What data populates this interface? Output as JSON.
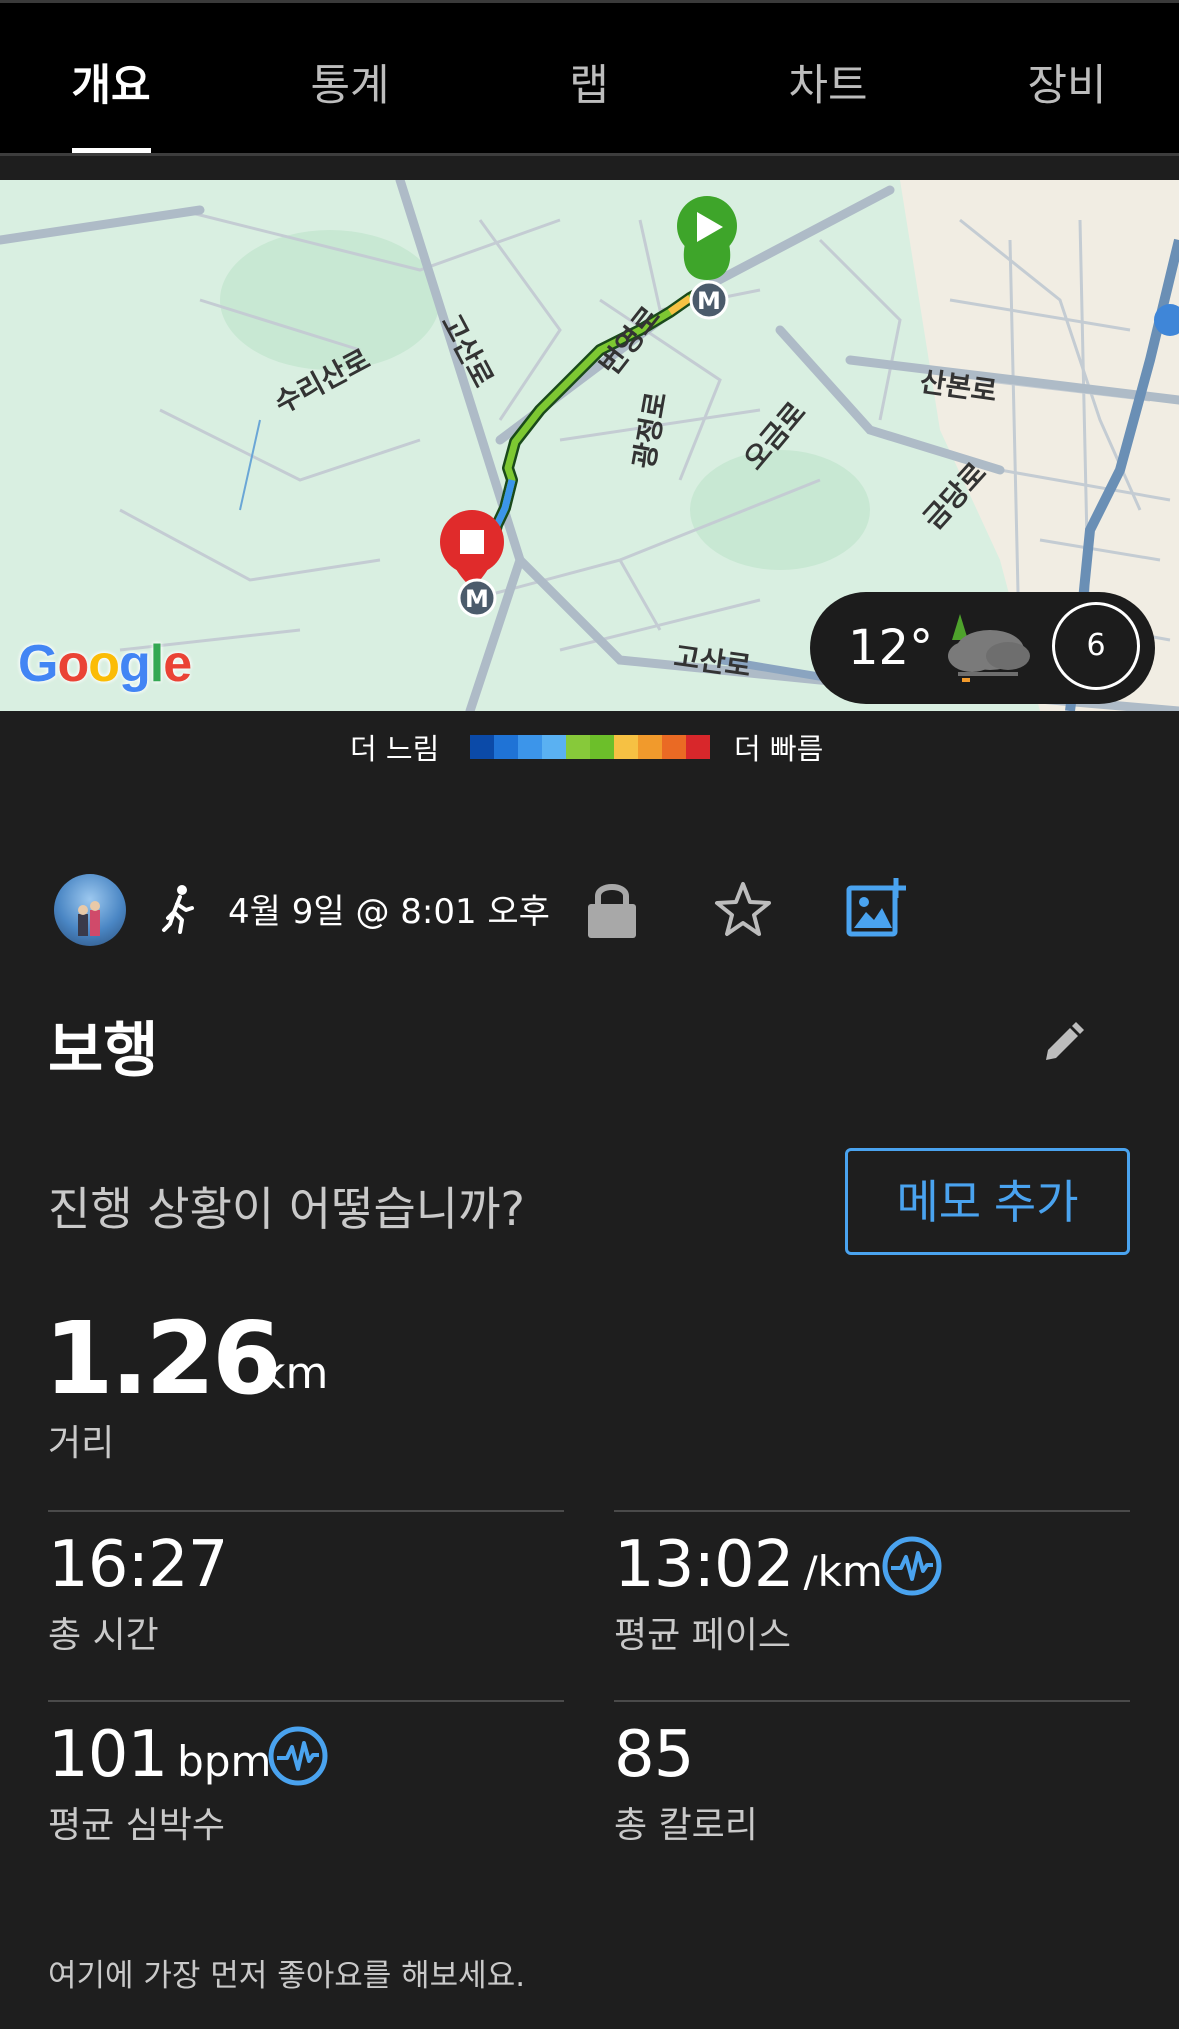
{
  "tabs": [
    {
      "label": "개요",
      "active": true
    },
    {
      "label": "통계",
      "active": false
    },
    {
      "label": "랩",
      "active": false
    },
    {
      "label": "차트",
      "active": false
    },
    {
      "label": "장비",
      "active": false
    }
  ],
  "map": {
    "street_labels": [
      "산본로",
      "수리산로",
      "고산로",
      "광정로",
      "오금로",
      "금당로",
      "고산로",
      "번영로"
    ],
    "brand": "Google",
    "weather": {
      "temperature": "12°",
      "wind": "6",
      "icon": "cloud-rain-icon"
    },
    "start_marker_icon": "play-icon",
    "end_marker_icon": "stop-icon",
    "metro_marker_letter": "M"
  },
  "legend": {
    "slow_label": "더 느림",
    "fast_label": "더 빠름",
    "colors": [
      "#0b4aa8",
      "#1f73d6",
      "#3c95ea",
      "#5ab1f2",
      "#87c93a",
      "#6cbf2a",
      "#f6c143",
      "#f19a2c",
      "#ea6a24",
      "#d8272b"
    ]
  },
  "activity": {
    "date": "4월 9일 @ 8:01 오후",
    "title": "보행",
    "prompt": "진행 상황이 어떻습니까?",
    "memo_button": "메모 추가"
  },
  "stats": {
    "distance": {
      "value": "1.26",
      "unit": "km",
      "label": "거리"
    },
    "total_time": {
      "value": "16:27",
      "label": "총 시간"
    },
    "avg_pace": {
      "value": "13:02",
      "unit": "/km",
      "label": "평균 페이스"
    },
    "avg_hr": {
      "value": "101",
      "unit": "bpm",
      "label": "평균 심박수"
    },
    "calories": {
      "value": "85",
      "label": "총 칼로리"
    }
  },
  "footer": {
    "text": "여기에 가장 먼저 좋아요를 해보세요."
  },
  "colors": {
    "accent": "#4aa3ef",
    "background": "#1e1e1e",
    "tabbar": "#000000"
  }
}
